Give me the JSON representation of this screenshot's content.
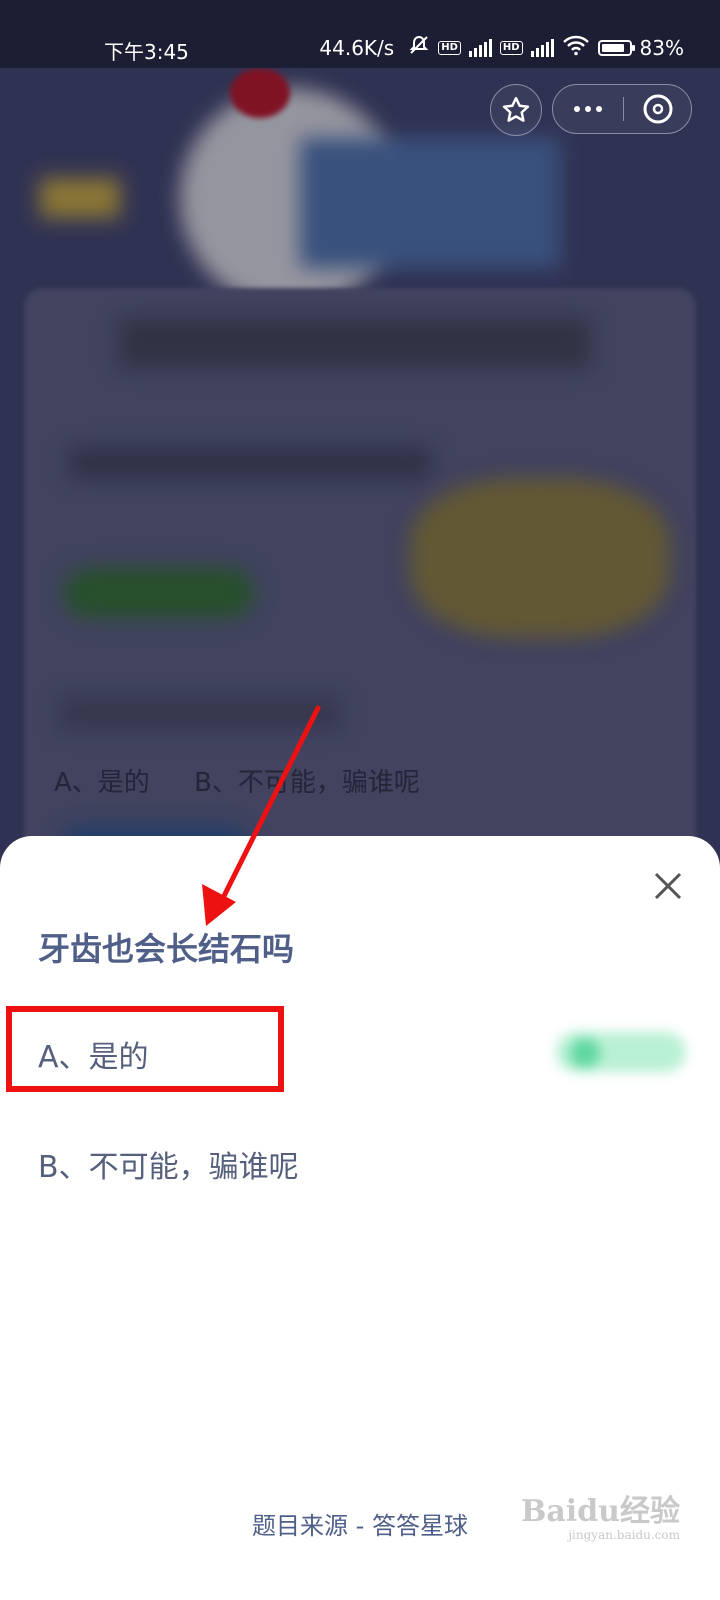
{
  "status_bar": {
    "time": "下午3:45",
    "network_speed": "44.6K/s",
    "battery": "83%"
  },
  "capsule": {
    "star_icon": "star-icon",
    "more_icon": "more-dots-icon",
    "close_icon": "close-circle-icon"
  },
  "background": {
    "option_a": "A、是的",
    "option_b": "B、不可能，骗谁呢"
  },
  "sheet": {
    "question": "牙齿也会长结石吗",
    "option_a": "A、是的",
    "option_b": "B、不可能，骗谁呢",
    "source": "题目来源 - 答答星球"
  },
  "watermark": {
    "brand": "Baidu经验",
    "url": "jingyan.baidu.com"
  },
  "colors": {
    "highlight_box": "#ee1111",
    "arrow": "#ee1111",
    "question": "#4f5f88"
  }
}
